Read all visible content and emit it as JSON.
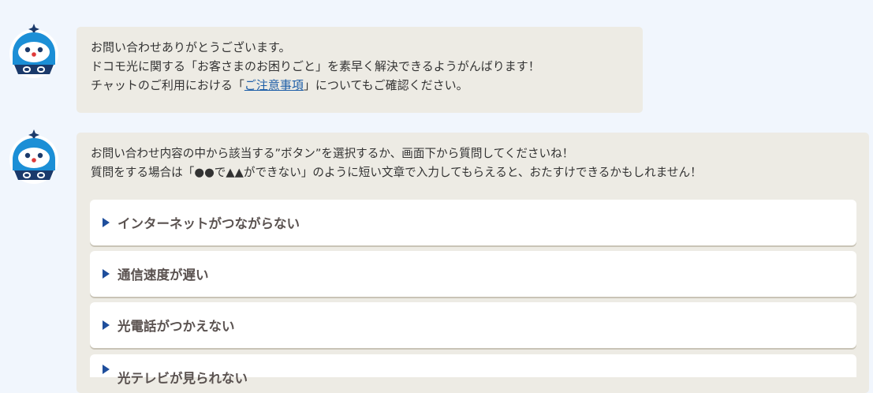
{
  "messages": [
    {
      "lines_a": "お問い合わせありがとうございます。",
      "lines_b": "ドコモ光に関する「お客さまのお困りごと」を素早く解決できるようがんばります！",
      "line_c_prefix": "チャットのご利用における「",
      "line_c_link": "ご注意事項",
      "line_c_suffix": "」についてもご確認ください。"
    },
    {
      "line_1": "お問い合わせ内容の中から該当する”ボタン”を選択するか、画面下から質問してくださいね！",
      "line_2": "質問をする場合は「●●で▲▲ができない」のように短い文章で入力してもらえると、おたすけできるかもしれません！"
    }
  ],
  "options": [
    "インターネットがつながらない",
    "通信速度が遅い",
    "光電話がつかえない",
    "光テレビが見られない"
  ],
  "colors": {
    "page_bg": "#f1f6fd",
    "bubble_bg": "#edebe4",
    "link": "#1f5fa8",
    "arrow": "#1e4e9c",
    "bot_blue": "#1c8fd6"
  },
  "icons": {
    "bot": "robot-mascot-icon",
    "option_arrow": "triangle-right-icon"
  }
}
